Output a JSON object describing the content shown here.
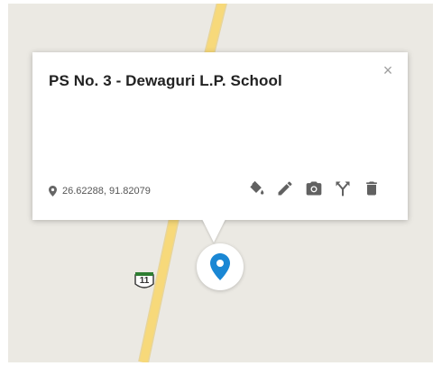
{
  "place": {
    "title": "PS No. 3 - Dewaguri L.P. School",
    "coordinates": "26.62288, 91.82079",
    "close_symbol": "×"
  },
  "map": {
    "route_shield_label": "11",
    "marker_color": "#1a87d4",
    "road_color": "#f7d97a"
  },
  "toolbar": {
    "icons": [
      "paint-bucket-icon",
      "pencil-icon",
      "camera-icon",
      "directions-icon",
      "trash-icon"
    ]
  }
}
